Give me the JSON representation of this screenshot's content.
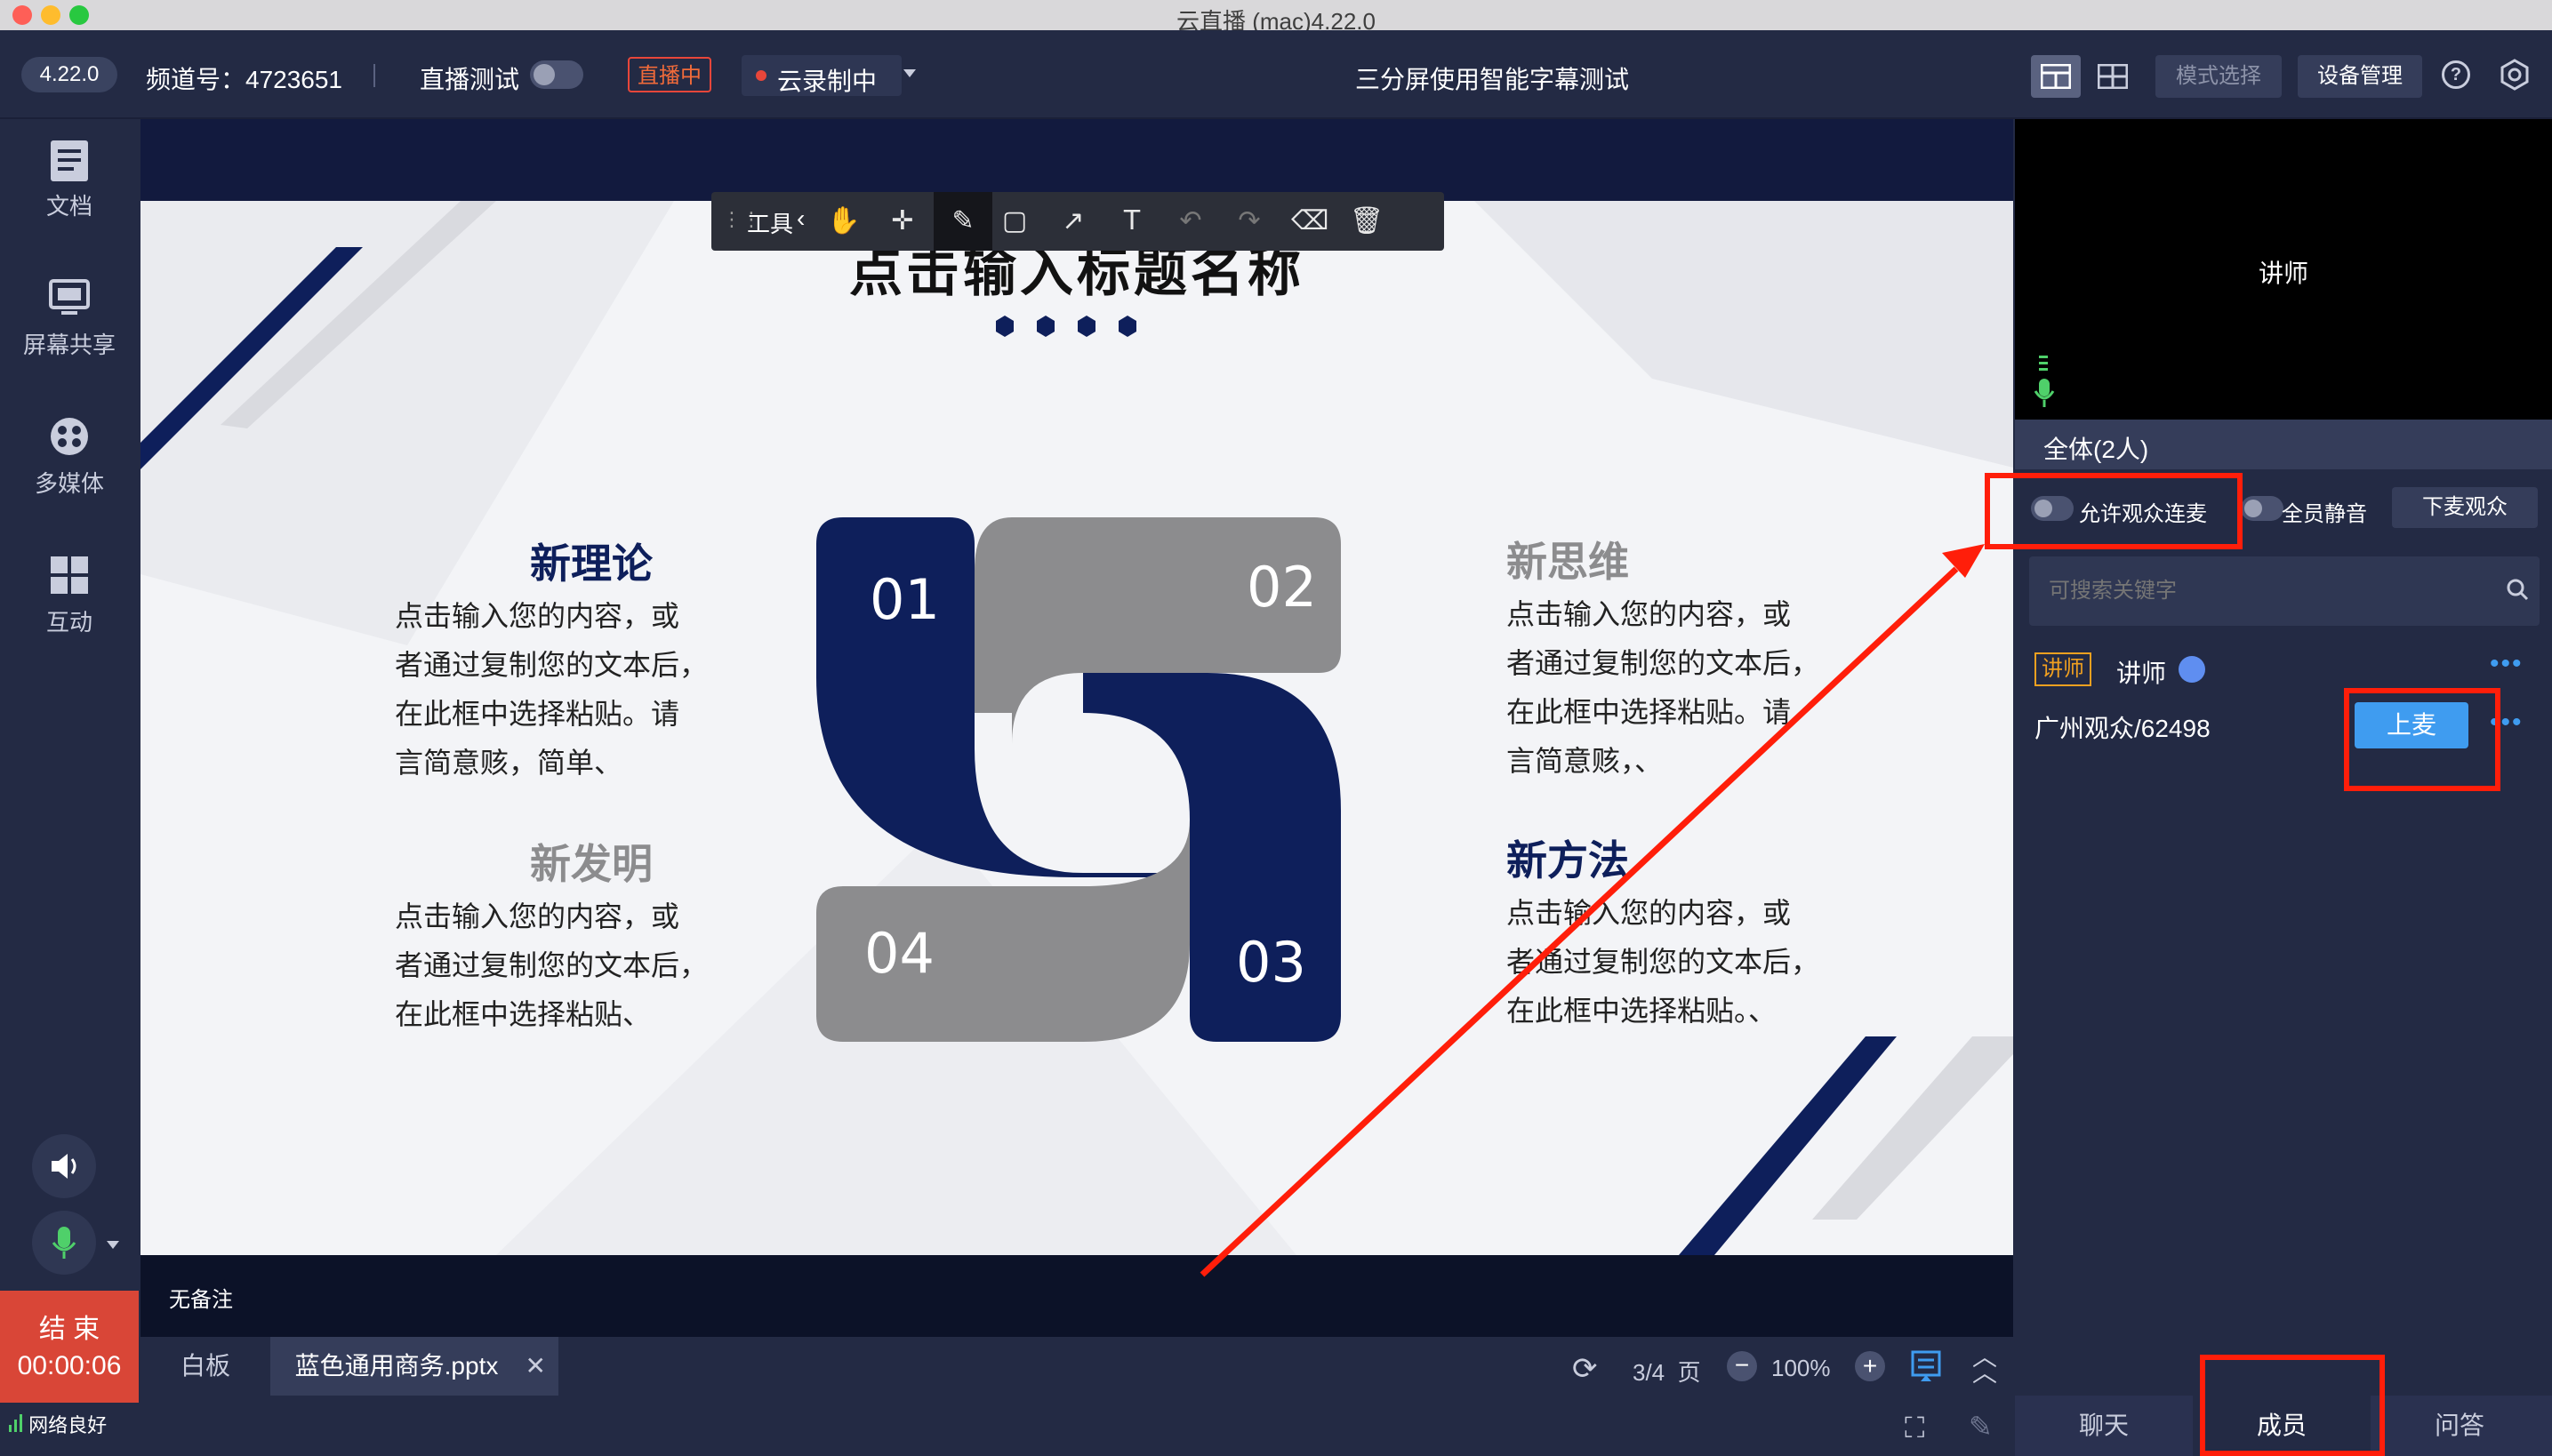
{
  "window": {
    "title": "云直播 (mac)4.22.0"
  },
  "topbar": {
    "version": "4.22.0",
    "channel": "频道号：4723651",
    "live_test": "直播测试",
    "live_badge": "直播中",
    "cloud_rec": "云录制中",
    "room_title": "三分屏使用智能字幕测试",
    "mode_select": "模式选择",
    "device_mgmt": "设备管理",
    "help_icon": "?"
  },
  "sidebar": {
    "items": [
      {
        "label": "文档",
        "icon": "document-icon"
      },
      {
        "label": "屏幕共享",
        "icon": "screen-share-icon"
      },
      {
        "label": "多媒体",
        "icon": "media-reel-icon"
      },
      {
        "label": "互动",
        "icon": "grid-icon"
      }
    ],
    "end_label": "结 束",
    "timer": "00:00:06",
    "network": "网络良好"
  },
  "toolbar": {
    "label": "工具",
    "tools": [
      "hand-icon",
      "move-icon",
      "pen-icon",
      "rectangle-icon",
      "arrow-icon",
      "text-icon",
      "undo-icon",
      "redo-icon",
      "eraser-icon",
      "trash-icon"
    ]
  },
  "slide": {
    "title": "点击输入标题名称",
    "sections": [
      {
        "heading": "新理论",
        "lines": [
          "点击输入您的内容，或",
          "者通过复制您的文本后，",
          "在此框中选择粘贴。请",
          "言简意赅，简单、"
        ]
      },
      {
        "heading": "新发明",
        "lines": [
          "点击输入您的内容，或",
          "者通过复制您的文本后，",
          "在此框中选择粘贴、"
        ]
      },
      {
        "heading": "新思维",
        "lines": [
          "点击输入您的内容，或",
          "者通过复制您的文本后，",
          "在此框中选择粘贴。请",
          "言简意赅，、"
        ]
      },
      {
        "heading": "新方法",
        "lines": [
          "点击输入您的内容，或",
          "者通过复制您的文本后，",
          "在此框中选择粘贴。、"
        ]
      }
    ],
    "numbers": [
      "01",
      "02",
      "03",
      "04"
    ],
    "colors": {
      "navy": "#0e1f5b",
      "gray": "#8c8c8e"
    }
  },
  "notes": {
    "text": "无备注"
  },
  "tabs": {
    "whiteboard": "白板",
    "file": "蓝色通用商务.pptx"
  },
  "pager": {
    "page": "3/4",
    "page_unit": "页",
    "zoom": "100%"
  },
  "right": {
    "video_label": "讲师",
    "all_members": "全体(2人)",
    "allow_audience": "允许观众连麦",
    "mute_all": "全员静音",
    "unmic_audience": "下麦观众",
    "search_placeholder": "可搜索关键字",
    "members": [
      {
        "badge": "讲师",
        "name": "讲师"
      },
      {
        "name": "广州观众/62498",
        "action": "上麦"
      }
    ],
    "tabs": [
      "聊天",
      "成员",
      "问答"
    ]
  },
  "accent_colors": {
    "highlight_red": "#ff1e0a",
    "blue_button": "#3f9cf0"
  }
}
